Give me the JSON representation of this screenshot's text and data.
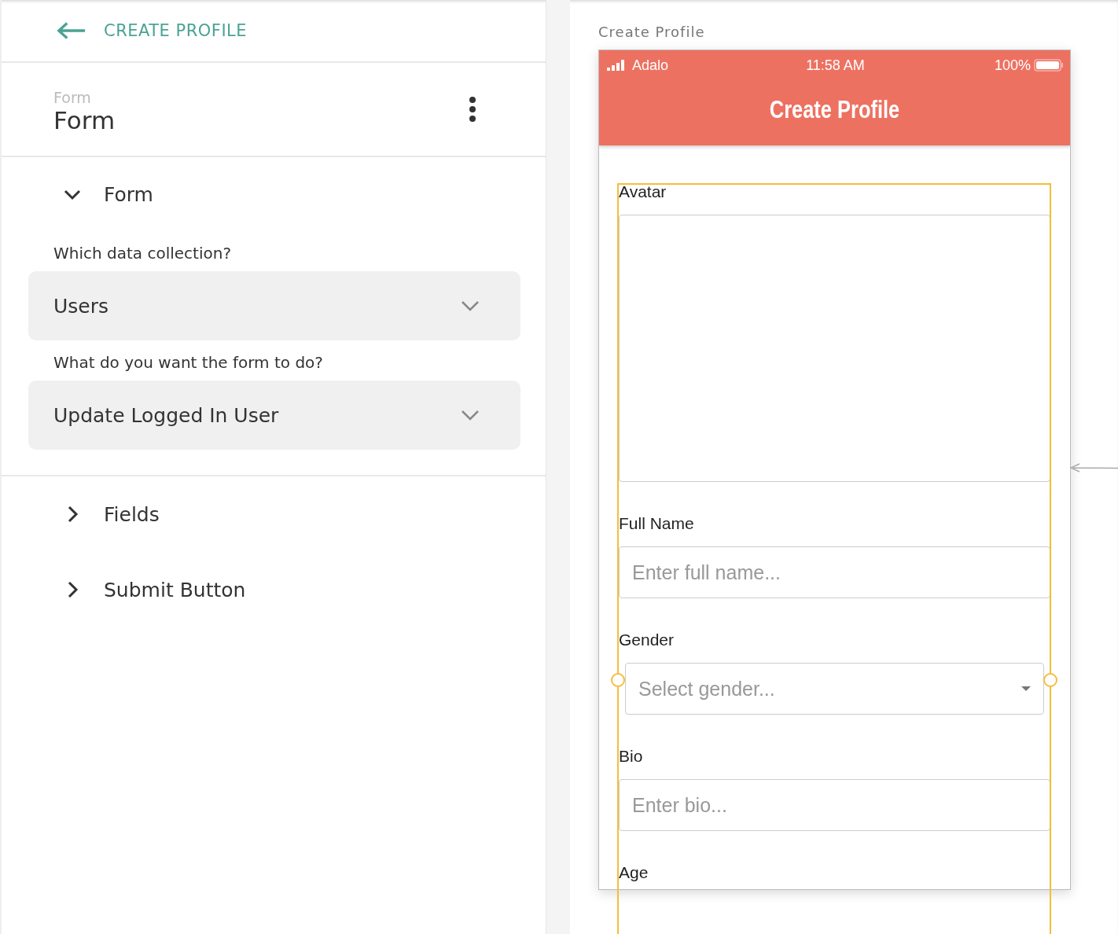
{
  "header": {
    "back_label": "CREATE PROFILE"
  },
  "component": {
    "type_label": "Form",
    "name": "Form"
  },
  "sections": [
    {
      "title": "Form",
      "expanded": true,
      "settings": [
        {
          "label": "Which data collection?",
          "value": "Users"
        },
        {
          "label": "What do you want the form to do?",
          "value": "Update Logged In User"
        }
      ]
    },
    {
      "title": "Fields",
      "expanded": false
    },
    {
      "title": "Submit Button",
      "expanded": false
    }
  ],
  "canvas": {
    "screen_label": "Create Profile",
    "status_bar": {
      "carrier": "Adalo",
      "time": "11:58 AM",
      "battery": "100%"
    },
    "app_bar_title": "Create Profile",
    "form_selected": true,
    "fields": [
      {
        "kind": "image",
        "label": "Avatar"
      },
      {
        "kind": "text",
        "label": "Full Name",
        "placeholder": "Enter full name..."
      },
      {
        "kind": "dropdown",
        "label": "Gender",
        "placeholder": "Select gender..."
      },
      {
        "kind": "text",
        "label": "Bio",
        "placeholder": "Enter bio..."
      },
      {
        "kind": "text",
        "label": "Age"
      }
    ]
  }
}
